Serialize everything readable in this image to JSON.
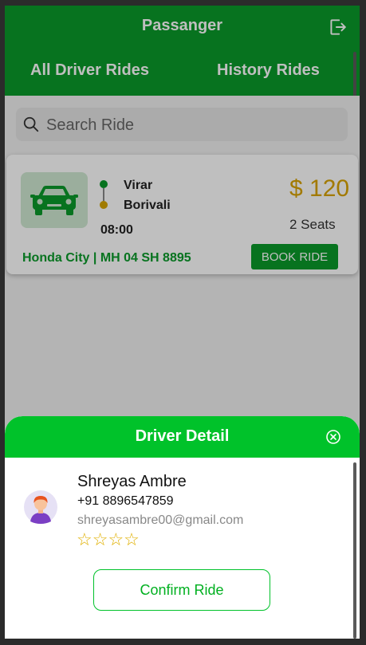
{
  "header": {
    "title": "Passanger",
    "tabs": [
      "All Driver Rides",
      "History Rides"
    ]
  },
  "search": {
    "placeholder": "Search Ride"
  },
  "ride": {
    "from": "Virar",
    "to": "Borivali",
    "time": "08:00",
    "price": "$ 120",
    "seats": "2 Seats",
    "vehicle": "Honda City | MH 04 SH 8895",
    "book_label": "BOOK RIDE"
  },
  "driver_sheet": {
    "title": "Driver Detail",
    "name": "Shreyas Ambre",
    "phone": "+91 8896547859",
    "email": "shreyasambre00@gmail.com",
    "rating_display": "☆☆☆☆",
    "confirm_label": "Confirm Ride"
  },
  "colors": {
    "header_green": "#0a9a2a",
    "sheet_green": "#00c22a",
    "price_gold": "#d9a300"
  },
  "icons": [
    "logout-icon",
    "search-icon",
    "car-icon",
    "close-icon",
    "avatar"
  ]
}
